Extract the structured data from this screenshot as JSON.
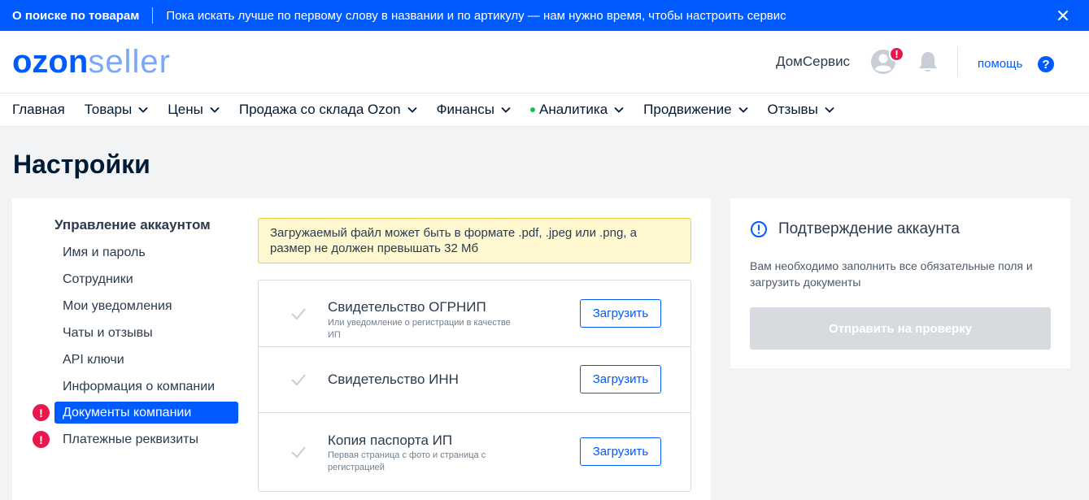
{
  "banner": {
    "title": "О поиске по товарам",
    "text": "Пока искать лучше по первому слову в названии и по артикулу — нам нужно время, чтобы настроить сервис",
    "close_icon": "close-icon"
  },
  "header": {
    "logo_ozon": "ozon",
    "logo_seller": "seller",
    "company": "ДомСервис",
    "avatar_badge": "!",
    "help_label": "помощь",
    "help_icon_text": "?"
  },
  "nav": {
    "items": [
      {
        "label": "Главная",
        "dropdown": false
      },
      {
        "label": "Товары",
        "dropdown": true
      },
      {
        "label": "Цены",
        "dropdown": true
      },
      {
        "label": "Продажа со склада Ozon",
        "dropdown": true
      },
      {
        "label": "Финансы",
        "dropdown": true
      },
      {
        "label": "Аналитика",
        "dropdown": true,
        "dot": true
      },
      {
        "label": "Продвижение",
        "dropdown": true
      },
      {
        "label": "Отзывы",
        "dropdown": true
      }
    ]
  },
  "page": {
    "title": "Настройки"
  },
  "sidebar": {
    "title": "Управление аккаунтом",
    "items": [
      {
        "label": "Имя и пароль",
        "active": false,
        "alert": false
      },
      {
        "label": "Сотрудники",
        "active": false,
        "alert": false
      },
      {
        "label": "Мои уведомления",
        "active": false,
        "alert": false
      },
      {
        "label": "Чаты и отзывы",
        "active": false,
        "alert": false
      },
      {
        "label": "API ключи",
        "active": false,
        "alert": false
      },
      {
        "label": "Информация о компании",
        "active": false,
        "alert": false
      },
      {
        "label": "Документы компании",
        "active": true,
        "alert": true
      },
      {
        "label": "Платежные реквизиты",
        "active": false,
        "alert": true
      }
    ],
    "alert_text": "!"
  },
  "notice": {
    "text": "Загружаемый файл может быть в формате .pdf, .jpeg или .png, а размер не должен превышать 32 Мб"
  },
  "documents": [
    {
      "title": "Свидетельство ОГРНИП",
      "subtitle": "Или уведомление о регистрации в качестве ИП",
      "button": "Загрузить"
    },
    {
      "title": "Свидетельство ИНН",
      "subtitle": "",
      "button": "Загрузить"
    },
    {
      "title": "Копия паспорта ИП",
      "subtitle": "Первая страница с фото и страница с регистрацией",
      "button": "Загрузить"
    }
  ],
  "verification": {
    "title": "Подтверждение аккаунта",
    "text": "Вам необходимо заполнить все обязательные поля и загрузить документы",
    "button": "Отправить на проверку"
  },
  "colors": {
    "brand": "#005bff",
    "alert": "#e8184d",
    "online": "#10c44c",
    "notice_bg": "#fff8d1"
  }
}
